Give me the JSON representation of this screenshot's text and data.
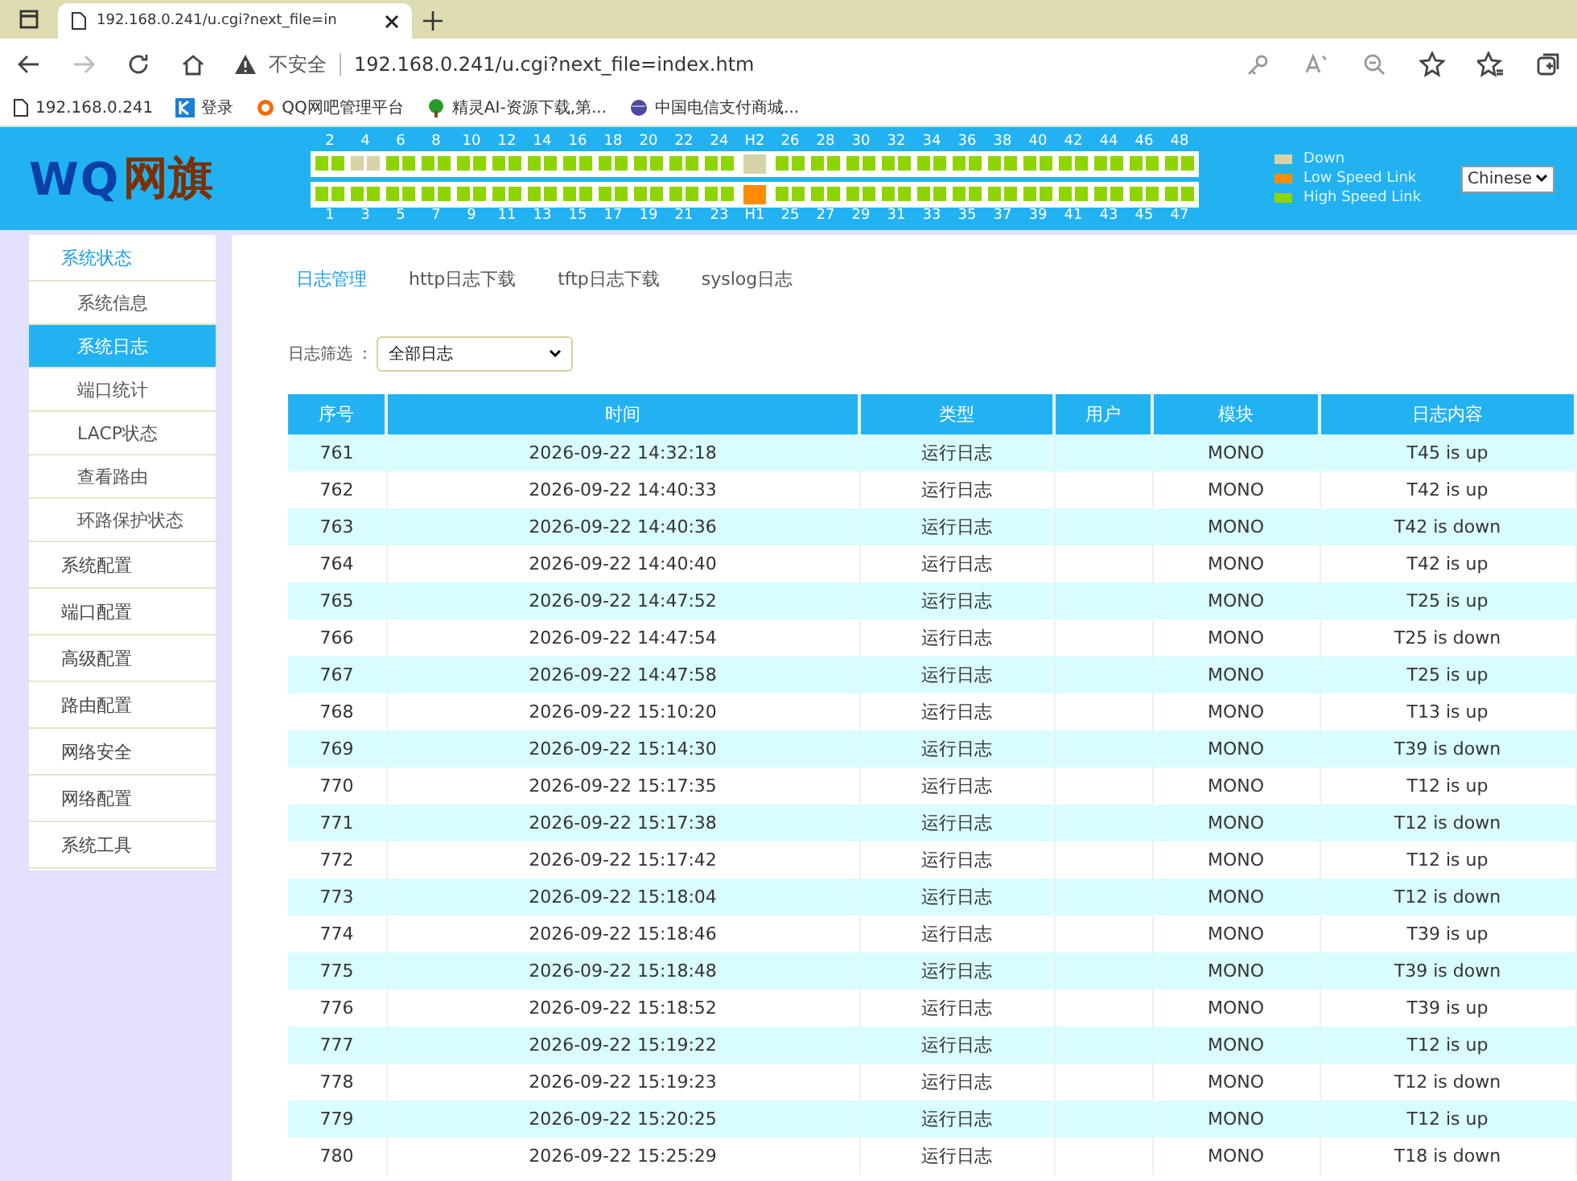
{
  "browser": {
    "tab_title": "192.168.0.241/u.cgi?next_file=in",
    "security": "不安全",
    "address": "192.168.0.241/u.cgi?next_file=index.htm",
    "bookmarks": [
      {
        "kind": "page",
        "label": "192.168.0.241"
      },
      {
        "kind": "k",
        "label": "登录"
      },
      {
        "kind": "ring",
        "label": "QQ网吧管理平台"
      },
      {
        "kind": "tree",
        "label": "精灵AI-资源下载,第..."
      },
      {
        "kind": "globe",
        "label": "中国电信支付商城..."
      }
    ]
  },
  "header": {
    "logo_latin": "WQ",
    "logo_cn": "网旗",
    "ports_top": [
      {
        "label": "2",
        "kind": "high"
      },
      {
        "label": "4",
        "kind": "down"
      },
      {
        "label": "6",
        "kind": "high"
      },
      {
        "label": "8",
        "kind": "high"
      },
      {
        "label": "10",
        "kind": "high"
      },
      {
        "label": "12",
        "kind": "high"
      },
      {
        "label": "14",
        "kind": "high"
      },
      {
        "label": "16",
        "kind": "high"
      },
      {
        "label": "18",
        "kind": "high"
      },
      {
        "label": "20",
        "kind": "high"
      },
      {
        "label": "22",
        "kind": "high"
      },
      {
        "label": "24",
        "kind": "high"
      },
      {
        "label": "H2",
        "kind": "down"
      },
      {
        "label": "26",
        "kind": "high"
      },
      {
        "label": "28",
        "kind": "high"
      },
      {
        "label": "30",
        "kind": "high"
      },
      {
        "label": "32",
        "kind": "high"
      },
      {
        "label": "34",
        "kind": "high"
      },
      {
        "label": "36",
        "kind": "high"
      },
      {
        "label": "38",
        "kind": "high"
      },
      {
        "label": "40",
        "kind": "high"
      },
      {
        "label": "42",
        "kind": "high"
      },
      {
        "label": "44",
        "kind": "high"
      },
      {
        "label": "46",
        "kind": "high"
      },
      {
        "label": "48",
        "kind": "high"
      }
    ],
    "ports_bottom": [
      {
        "label": "1",
        "kind": "high"
      },
      {
        "label": "3",
        "kind": "high"
      },
      {
        "label": "5",
        "kind": "high"
      },
      {
        "label": "7",
        "kind": "high"
      },
      {
        "label": "9",
        "kind": "high"
      },
      {
        "label": "11",
        "kind": "high"
      },
      {
        "label": "13",
        "kind": "high"
      },
      {
        "label": "15",
        "kind": "high"
      },
      {
        "label": "17",
        "kind": "high"
      },
      {
        "label": "19",
        "kind": "high"
      },
      {
        "label": "21",
        "kind": "high"
      },
      {
        "label": "23",
        "kind": "high"
      },
      {
        "label": "H1",
        "kind": "low"
      },
      {
        "label": "25",
        "kind": "high"
      },
      {
        "label": "27",
        "kind": "high"
      },
      {
        "label": "29",
        "kind": "high"
      },
      {
        "label": "31",
        "kind": "high"
      },
      {
        "label": "33",
        "kind": "high"
      },
      {
        "label": "35",
        "kind": "high"
      },
      {
        "label": "37",
        "kind": "high"
      },
      {
        "label": "39",
        "kind": "high"
      },
      {
        "label": "41",
        "kind": "high"
      },
      {
        "label": "43",
        "kind": "high"
      },
      {
        "label": "45",
        "kind": "high"
      },
      {
        "label": "47",
        "kind": "high"
      }
    ],
    "legend": [
      {
        "label": "Down",
        "color": "#d8d2a8"
      },
      {
        "label": "Low Speed Link",
        "color": "#ff8c00"
      },
      {
        "label": "High Speed Link",
        "color": "#8ed400"
      }
    ],
    "language": "Chinese"
  },
  "sidebar": {
    "items": [
      {
        "label": "系统状态",
        "selected": false,
        "expanded": true,
        "children": [
          {
            "label": "系统信息",
            "selected": false
          },
          {
            "label": "系统日志",
            "selected": true
          },
          {
            "label": "端口统计",
            "selected": false
          },
          {
            "label": "LACP状态",
            "selected": false
          },
          {
            "label": "查看路由",
            "selected": false
          },
          {
            "label": "环路保护状态",
            "selected": false
          }
        ]
      },
      {
        "label": "系统配置",
        "selected": false,
        "expanded": false
      },
      {
        "label": "端口配置",
        "selected": false,
        "expanded": false
      },
      {
        "label": "高级配置",
        "selected": false,
        "expanded": false
      },
      {
        "label": "路由配置",
        "selected": false,
        "expanded": false
      },
      {
        "label": "网络安全",
        "selected": false,
        "expanded": false
      },
      {
        "label": "网络配置",
        "selected": false,
        "expanded": false
      },
      {
        "label": "系统工具",
        "selected": false,
        "expanded": false
      }
    ]
  },
  "tabs": [
    {
      "label": "日志管理",
      "selected": true
    },
    {
      "label": "http日志下载",
      "selected": false
    },
    {
      "label": "tftp日志下载",
      "selected": false
    },
    {
      "label": "syslog日志",
      "selected": false
    }
  ],
  "filter": {
    "label": "日志筛选",
    "separator": ":",
    "value": "全部日志"
  },
  "table": {
    "columns": [
      "序号",
      "时间",
      "类型",
      "用户",
      "模块",
      "日志内容"
    ],
    "rows": [
      [
        "761",
        "2026-09-22 14:32:18",
        "运行日志",
        "",
        "MONO",
        "T45 is up"
      ],
      [
        "762",
        "2026-09-22 14:40:33",
        "运行日志",
        "",
        "MONO",
        "T42 is up"
      ],
      [
        "763",
        "2026-09-22 14:40:36",
        "运行日志",
        "",
        "MONO",
        "T42 is down"
      ],
      [
        "764",
        "2026-09-22 14:40:40",
        "运行日志",
        "",
        "MONO",
        "T42 is up"
      ],
      [
        "765",
        "2026-09-22 14:47:52",
        "运行日志",
        "",
        "MONO",
        "T25 is up"
      ],
      [
        "766",
        "2026-09-22 14:47:54",
        "运行日志",
        "",
        "MONO",
        "T25 is down"
      ],
      [
        "767",
        "2026-09-22 14:47:58",
        "运行日志",
        "",
        "MONO",
        "T25 is up"
      ],
      [
        "768",
        "2026-09-22 15:10:20",
        "运行日志",
        "",
        "MONO",
        "T13 is up"
      ],
      [
        "769",
        "2026-09-22 15:14:30",
        "运行日志",
        "",
        "MONO",
        "T39 is down"
      ],
      [
        "770",
        "2026-09-22 15:17:35",
        "运行日志",
        "",
        "MONO",
        "T12 is up"
      ],
      [
        "771",
        "2026-09-22 15:17:38",
        "运行日志",
        "",
        "MONO",
        "T12 is down"
      ],
      [
        "772",
        "2026-09-22 15:17:42",
        "运行日志",
        "",
        "MONO",
        "T12 is up"
      ],
      [
        "773",
        "2026-09-22 15:18:04",
        "运行日志",
        "",
        "MONO",
        "T12 is down"
      ],
      [
        "774",
        "2026-09-22 15:18:46",
        "运行日志",
        "",
        "MONO",
        "T39 is up"
      ],
      [
        "775",
        "2026-09-22 15:18:48",
        "运行日志",
        "",
        "MONO",
        "T39 is down"
      ],
      [
        "776",
        "2026-09-22 15:18:52",
        "运行日志",
        "",
        "MONO",
        "T39 is up"
      ],
      [
        "777",
        "2026-09-22 15:19:22",
        "运行日志",
        "",
        "MONO",
        "T12 is up"
      ],
      [
        "778",
        "2026-09-22 15:19:23",
        "运行日志",
        "",
        "MONO",
        "T12 is down"
      ],
      [
        "779",
        "2026-09-22 15:20:25",
        "运行日志",
        "",
        "MONO",
        "T12 is up"
      ],
      [
        "780",
        "2026-09-22 15:25:29",
        "运行日志",
        "",
        "MONO",
        "T18 is down"
      ]
    ]
  }
}
